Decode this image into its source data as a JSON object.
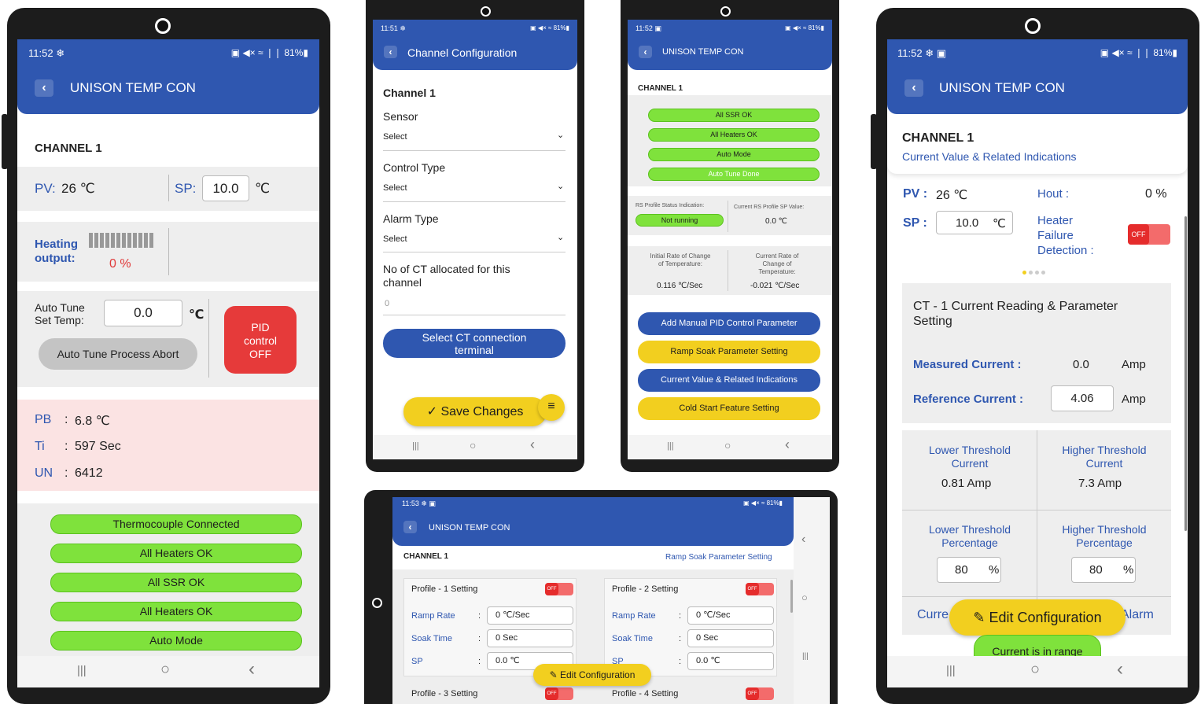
{
  "p1": {
    "time": "11:52",
    "status_icons": "❄",
    "status_right": "▣ ◀× ≈ ❘❘ 81%▮",
    "title": "UNISON TEMP CON",
    "channel": "CHANNEL 1",
    "pv_label": "PV:",
    "pv_value": "26 ℃",
    "sp_label": "SP:",
    "sp_value": "10.0",
    "sp_unit": "℃",
    "heating_label": "Heating\noutput:",
    "heating_value": "0 %",
    "autotune_label": "Auto Tune\nSet Temp:",
    "autotune_value": "0.0",
    "autotune_unit": "℃",
    "abort_btn": "Auto Tune Process Abort",
    "pid_btn": "PID\ncontrol\nOFF",
    "pb_label": "PB",
    "pb_value": "6.8 ℃",
    "ti_label": "Ti",
    "ti_value": "597 Sec",
    "un_label": "UN",
    "un_value": "6412",
    "colon": ":",
    "indicators": [
      "Thermocouple Connected",
      "All Heaters OK",
      "All SSR OK",
      "All Heaters OK",
      "Auto Mode"
    ]
  },
  "p2": {
    "time": "11:51",
    "status_icons": "❄",
    "status_right": "▣ ◀× ≈ 81%▮",
    "title": "Channel Configuration",
    "channel": "Channel 1",
    "sensor_label": "Sensor",
    "sensor_value": "Select",
    "ctrl_label": "Control Type",
    "ctrl_value": "Select",
    "alarm_label": "Alarm Type",
    "alarm_value": "Select",
    "ct_label": "No of CT allocated for this channel",
    "ct_value": "0",
    "ct_btn": "Select CT connection terminal",
    "save_btn": "✓ Save Changes"
  },
  "p3": {
    "time": "11:52",
    "status_icons": "▣",
    "status_right": "▣ ◀× ≈ 81%▮",
    "title": "UNISON TEMP CON",
    "channel": "CHANNEL 1",
    "pills": [
      "All SSR OK",
      "All Heaters OK",
      "Auto Mode",
      "Auto Tune Done"
    ],
    "rs_label": "RS Profile Status Indication:",
    "rs_value": "Not running",
    "csp_label": "Current RS Profile SP Value:",
    "csp_value": "0.0 ℃",
    "irate_label": "Initial Rate of Change of Temperature:",
    "irate_value": "0.116 ℃/Sec",
    "crate_label": "Current Rate of Change of Temperature:",
    "crate_value": "-0.021 ℃/Sec",
    "btns": [
      "Add Manual PID Control Parameter",
      "Ramp Soak Parameter Setting",
      "Current Value & Related Indications",
      "Cold Start Feature Setting"
    ]
  },
  "p4": {
    "time": "11:53",
    "status_icons": "❄ ▣",
    "status_right": "▣ ◀× ≈ 81%▮",
    "title": "UNISON TEMP CON",
    "channel": "CHANNEL 1",
    "link": "Ramp Soak Parameter Setting",
    "profile1": "Profile - 1 Setting",
    "profile2": "Profile - 2 Setting",
    "profile3": "Profile - 3 Setting",
    "profile4": "Profile - 4 Setting",
    "ramp": "Ramp Rate",
    "soak": "Soak Time",
    "sp": "SP",
    "colon": ":",
    "ramp_val": "0 ℃/Sec",
    "soak_val": "0 Sec",
    "sp_val": "0.0 ℃",
    "off": "OFF",
    "edit_btn": "✎ Edit Configuration"
  },
  "p5": {
    "time": "11:52",
    "status_icons": "❄ ▣",
    "status_right": "▣ ◀× ≈ ❘❘ 81%▮",
    "title": "UNISON TEMP CON",
    "channel": "CHANNEL 1",
    "subtitle": "Current Value & Related Indications",
    "pv_label": "PV :",
    "pv_value": "26 ℃",
    "hout_label": "Hout :",
    "hout_value": "0 %",
    "sp_label": "SP :",
    "sp_value": "10.0",
    "sp_unit": "℃",
    "hfd_label": "Heater\nFailure\nDetection :",
    "off": "OFF",
    "ct_title": "CT - 1 Current Reading & Parameter Setting",
    "meas_label": "Measured Current :",
    "meas_value": "0.0",
    "amp": "Amp",
    "ref_label": "Reference Current :",
    "ref_value": "4.06",
    "ltc_label": "Lower Threshold Current",
    "ltc_value": "0.81 Amp",
    "htc_label": "Higher Threshold Current",
    "htc_value": "7.3 Amp",
    "ltp_label": "Lower Threshold Percentage",
    "ltp_value": "80",
    "htp_label": "Higher Threshold Percentage",
    "htp_value": "80",
    "pct": "%",
    "curr_partial": "Curre",
    "alarm_partial": "Alarm",
    "edit_btn": "✎ Edit Configuration",
    "range": "Current is in range"
  },
  "nav": {
    "recent": "|||",
    "home": "○",
    "back": "‹",
    "chev_down": "⌄",
    "chev_left": "‹"
  }
}
